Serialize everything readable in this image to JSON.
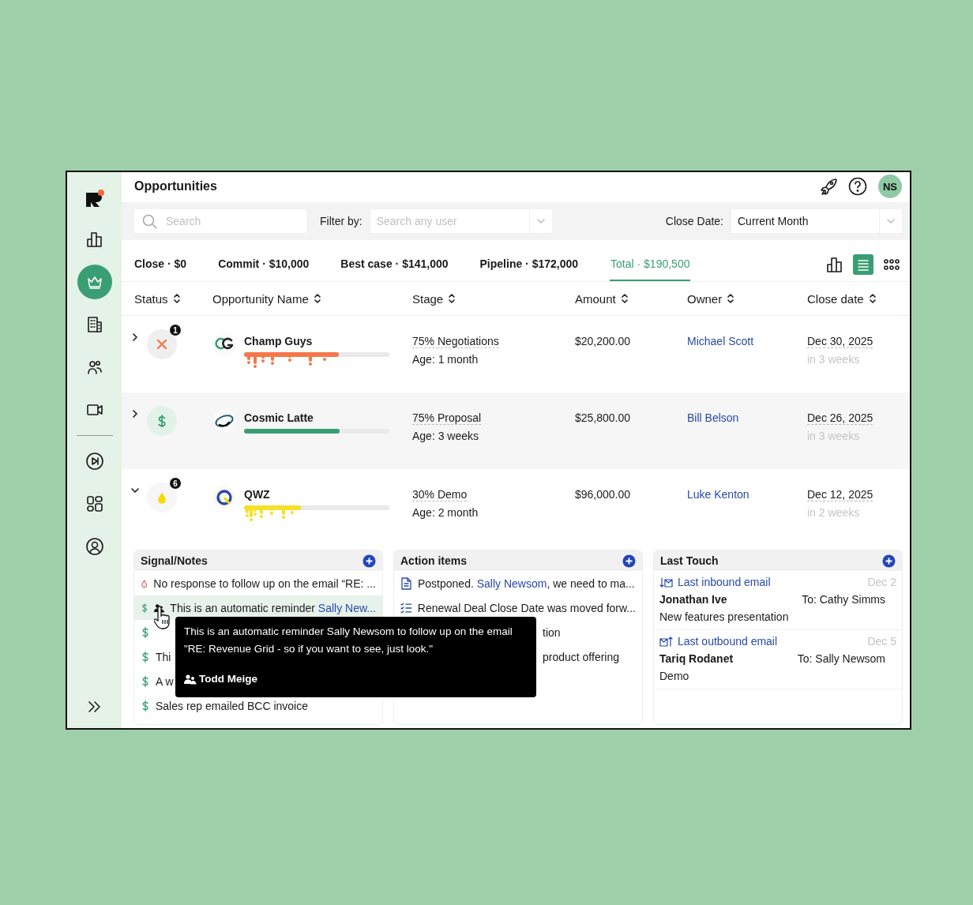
{
  "sidebar": {
    "groups": [
      [
        {
          "selected": false
        },
        {
          "selected": true
        },
        {
          "selected": false
        },
        {
          "selected": false
        },
        {
          "selected": false
        }
      ],
      [
        {
          "selected": false
        },
        {
          "selected": false
        },
        {
          "selected": false
        }
      ]
    ]
  },
  "header": {
    "title": "Opportunities",
    "avatar": "NS"
  },
  "filters": {
    "search": {
      "placeholder": "Search"
    },
    "filter_label": "Filter by:",
    "user_search": {
      "placeholder": "Search any user"
    },
    "close_date_label": "Close Date:",
    "close_date": "Current Month"
  },
  "summary_tabs": [
    {
      "label": "Close · $0",
      "selected": false
    },
    {
      "label": "Commit · $10,000",
      "selected": false
    },
    {
      "label": "Best case · $141,000",
      "selected": false
    },
    {
      "label": "Pipeline · $172,000",
      "selected": false
    },
    {
      "label": "Total · $190,500",
      "selected": true
    }
  ],
  "view_toggles": [
    {
      "kind": "chart",
      "selected": false
    },
    {
      "kind": "list",
      "selected": true
    },
    {
      "kind": "grid",
      "selected": false
    }
  ],
  "table": {
    "columns": [
      "Status",
      "Opportunity Name",
      "Stage",
      "Amount",
      "Owner",
      "Close date"
    ],
    "rows": [
      {
        "expanded": false,
        "kind": "lost",
        "badge": "1",
        "name": "Champ Guys",
        "level": 0.65,
        "color": "#f4784a",
        "dripping": true,
        "stage": "75% Negotiations",
        "age": "Age: 1 month",
        "amount": "$20,200.00",
        "owner": "Michael Scott",
        "close_date": "Dec 30, 2025",
        "relative": "in 3 weeks"
      },
      {
        "expanded": false,
        "kind": "won",
        "name": "Cosmic Latte",
        "level": 0.66,
        "color": "#3a9e74",
        "dripping": false,
        "stage": "75% Proposal",
        "age": "Age: 3 weeks",
        "amount": "$25,800.00",
        "owner": "Bill Belson",
        "close_date": "Dec 26, 2025",
        "relative": "in 3 weeks"
      },
      {
        "expanded": true,
        "kind": "hot",
        "badge": "6",
        "name": "QWZ",
        "level": 0.39,
        "color": "#f5e02a",
        "dripping": true,
        "stage": "30% Demo",
        "age": "Age: 2 month",
        "amount": "$96,000.00",
        "owner": "Luke Kenton",
        "close_date": "Dec 12, 2025",
        "relative": "in 2 weeks"
      }
    ]
  },
  "signals": {
    "title": "Signal/Notes",
    "items": [
      {
        "kind": "drop",
        "selected": false,
        "parts": [
          {
            "text": "No response to follow up on the email “RE: ..."
          }
        ]
      },
      {
        "kind": "dollar",
        "selected": true,
        "person": true,
        "parts": [
          {
            "text": "This is an automatic reminder "
          },
          {
            "link": "Sally New..."
          }
        ]
      },
      {
        "kind": "dollar",
        "selected": false
      },
      {
        "kind": "dollar",
        "selected": false,
        "parts": [
          {
            "text": "Thi"
          }
        ]
      },
      {
        "kind": "dollar",
        "selected": false,
        "parts": [
          {
            "text": "A w"
          }
        ]
      },
      {
        "kind": "dollar",
        "selected": false,
        "parts": [
          {
            "text": "Sales rep emailed BCC invoice"
          }
        ]
      }
    ]
  },
  "action_items": {
    "title": "Action items",
    "items": [
      {
        "kind": "doc",
        "parts": [
          {
            "text": "Postponed. "
          },
          {
            "link": "Sally Newsom"
          },
          {
            "text": ", we need to ma..."
          }
        ]
      },
      {
        "kind": "list",
        "parts": [
          {
            "text": "Renewal Deal Close Date was moved forw..."
          }
        ]
      },
      {
        "parts": [
          {
            "text": "tion"
          }
        ]
      },
      {
        "parts": [
          {
            "text": "product offering"
          }
        ]
      }
    ]
  },
  "last_touch": {
    "title": "Last Touch",
    "items": [
      {
        "kind": "inbound",
        "label": "Last inbound email",
        "date": "Dec 2",
        "from": "Jonathan Ive",
        "to": "To: Cathy Simms",
        "subject": "New features presentation"
      },
      {
        "kind": "outbound",
        "label": "Last outbound email",
        "date": "Dec 5",
        "from": "Tariq Rodanet",
        "to": "To: Sally Newsom",
        "subject": "Demo"
      }
    ]
  },
  "tooltip": {
    "text": "This is an automatic reminder Sally Newsom to follow up on the email \"RE: Revenue Grid - so if you want to see, just look.\"",
    "author": "Todd Meige"
  }
}
